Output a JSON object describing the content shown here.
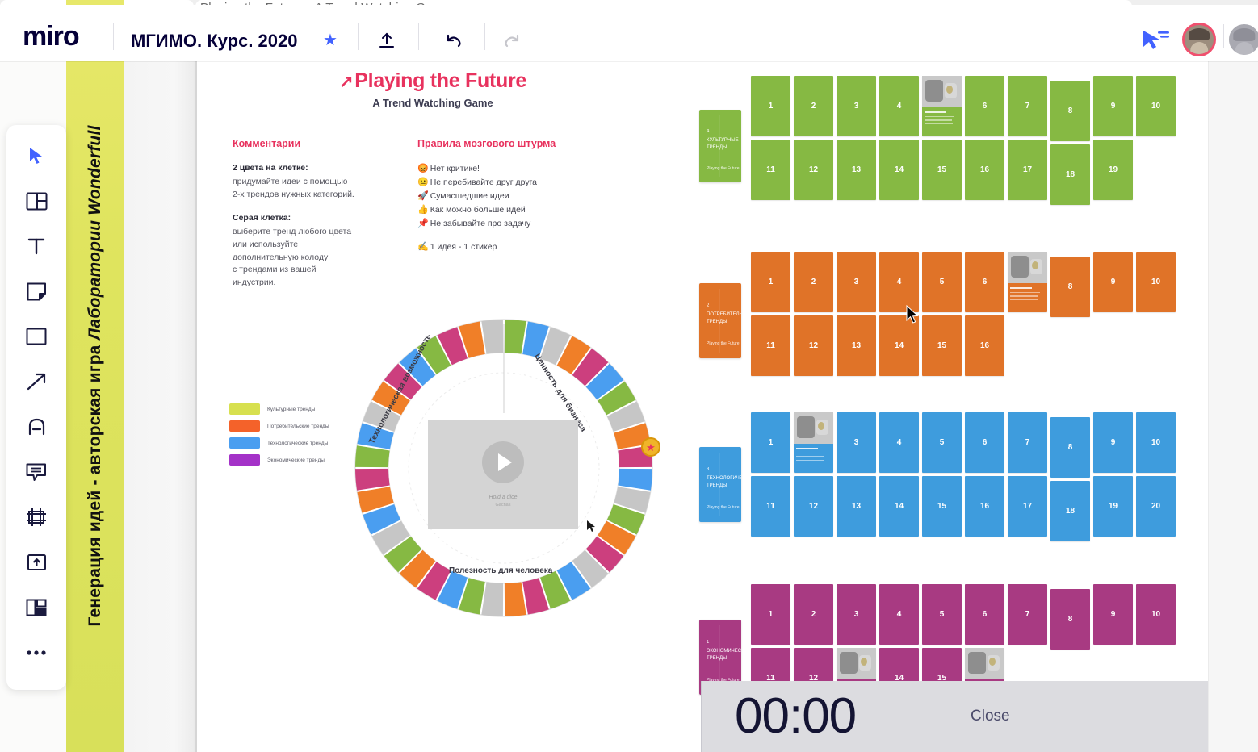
{
  "browser": {
    "tab_title": "Playing the Future – A Trend Watching Game"
  },
  "topbar": {
    "logo": "miro",
    "board_title": "МГИМО. Курс. 2020",
    "star_icon": "star-icon",
    "upload_icon": "upload-icon",
    "undo_icon": "undo-icon",
    "redo_icon": "redo-icon",
    "presence_icon": "presence-cursor-icon"
  },
  "toolbar": {
    "items": [
      {
        "name": "select-tool",
        "icon": "cursor-icon"
      },
      {
        "name": "templates-tool",
        "icon": "templates-icon"
      },
      {
        "name": "text-tool",
        "icon": "text-icon"
      },
      {
        "name": "sticky-tool",
        "icon": "sticky-note-icon"
      },
      {
        "name": "shape-tool",
        "icon": "rectangle-icon"
      },
      {
        "name": "line-tool",
        "icon": "arrow-icon"
      },
      {
        "name": "pen-tool",
        "icon": "pen-icon"
      },
      {
        "name": "comment-tool",
        "icon": "comment-icon"
      },
      {
        "name": "frame-tool",
        "icon": "frame-icon"
      },
      {
        "name": "upload-tool",
        "icon": "upload-box-icon"
      },
      {
        "name": "cards-tool",
        "icon": "grid-cards-icon"
      },
      {
        "name": "more-tool",
        "icon": "more-dots-icon"
      }
    ]
  },
  "banner": {
    "vertical_text_plain": "Генерация идей - авторская игра ",
    "vertical_text_italic": "Лаборатории Wonderfull",
    "color": "#dfe45e"
  },
  "header": {
    "title": "Playing the Future",
    "title_arrow": "↗",
    "subtitle": "A Trend Watching Game",
    "title_color": "#e8325e"
  },
  "comments": {
    "heading": "Комментарии",
    "blocks": [
      {
        "title": "2 цвета на клетке:",
        "lines": [
          "придумайте идеи с помощью",
          "2-х трендов нужных категорий."
        ]
      },
      {
        "title": "Серая клетка:",
        "lines": [
          "выберите тренд любого цвета",
          "или используйте",
          "дополнительную колоду",
          "с трендами из вашей",
          "индустрии."
        ]
      }
    ]
  },
  "rules": {
    "heading": "Правила мозгового штурма",
    "items": [
      {
        "emoji": "😡",
        "text": "Нет критике!"
      },
      {
        "emoji": "😐",
        "text": "Не перебивайте друг друга"
      },
      {
        "emoji": "🚀",
        "text": "Сумасшедшие идеи"
      },
      {
        "emoji": "👍",
        "text": "Как можно больше идей"
      },
      {
        "emoji": "📌",
        "text": "Не забывайте про задачу"
      }
    ],
    "footer": {
      "emoji": "✍",
      "text": "1 идея - 1 стикер"
    }
  },
  "legend": {
    "items": [
      {
        "label": "Культурные тренды",
        "color": "#d7e04f"
      },
      {
        "label": "Потребительские тренды",
        "color": "#f4622a"
      },
      {
        "label": "Технологические тренды",
        "color": "#4a9ef0"
      },
      {
        "label": "Экономические тренды",
        "color": "#a432c8"
      }
    ]
  },
  "board": {
    "labels": [
      "Технологическая возможность",
      "Ценность для бизнеса",
      "Полезность для человека"
    ],
    "video": {
      "title": "Hold a dice",
      "caption": "Gachas"
    },
    "medal_icon": "medal-star-icon",
    "segment_colors": [
      "#86b943",
      "#f07f28",
      "#4a9ef0",
      "#cc3f7e",
      "#c6c6c6"
    ]
  },
  "decks": [
    {
      "name": "green-deck",
      "color": "#86b943",
      "cover": {
        "no": "4",
        "title": "КУЛЬТУРНЫЕ ТРЕНДЫ",
        "footer": "Playing the Future"
      },
      "row1": [
        "1",
        "2",
        "3",
        "4",
        "5",
        "6",
        "7",
        "8",
        "9",
        "10"
      ],
      "row2": [
        "11",
        "12",
        "13",
        "14",
        "15",
        "16",
        "17",
        "18",
        "19"
      ],
      "photo_cards": [
        "5"
      ]
    },
    {
      "name": "orange-deck",
      "color": "#e07328",
      "cover": {
        "no": "2",
        "title": "ПОТРЕБИТЕЛЬСКИЕ ТРЕНДЫ",
        "footer": "Playing the Future"
      },
      "row1": [
        "1",
        "2",
        "3",
        "4",
        "5",
        "6",
        "7",
        "8",
        "9",
        "10"
      ],
      "row2": [
        "11",
        "12",
        "13",
        "14",
        "15",
        "16"
      ],
      "photo_cards": [
        "7"
      ]
    },
    {
      "name": "blue-deck",
      "color": "#3e9cdd",
      "cover": {
        "no": "3",
        "title": "ТЕХНОЛОГИЧЕСКИЕ ТРЕНДЫ",
        "footer": "Playing the Future"
      },
      "row1": [
        "1",
        "2",
        "3",
        "4",
        "5",
        "6",
        "7",
        "8",
        "9",
        "10"
      ],
      "row2": [
        "11",
        "12",
        "13",
        "14",
        "15",
        "16",
        "17",
        "18",
        "19",
        "20"
      ],
      "photo_cards": [
        "2"
      ]
    },
    {
      "name": "magenta-deck",
      "color": "#a83a82",
      "cover": {
        "no": "1",
        "title": "ЭКОНОМИЧЕСКИЕ ТРЕНДЫ",
        "footer": "Playing the Future"
      },
      "row1": [
        "1",
        "2",
        "3",
        "4",
        "5",
        "6",
        "7",
        "8",
        "9",
        "10"
      ],
      "row2": [
        "11",
        "12",
        "13",
        "14",
        "15",
        "16"
      ],
      "photo_cards": [
        "13",
        "16"
      ]
    }
  ],
  "timer": {
    "value": "00:00",
    "close_label": "Close"
  }
}
